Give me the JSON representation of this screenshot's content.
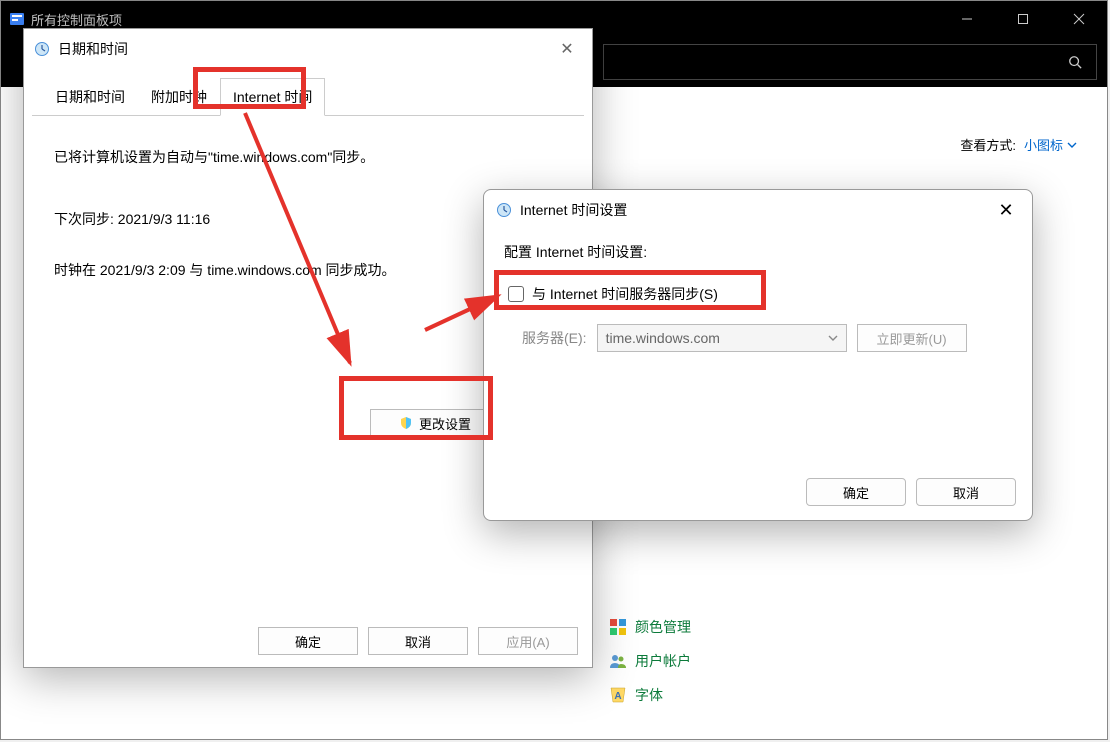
{
  "main_window": {
    "title": "所有控制面板项"
  },
  "view": {
    "label": "查看方式:",
    "link": "小图标"
  },
  "cp_items": [
    {
      "label": "颜色管理"
    },
    {
      "label": "用户帐户"
    },
    {
      "label": "字体"
    }
  ],
  "dt_dialog": {
    "title": "日期和时间",
    "tabs": [
      "日期和时间",
      "附加时钟",
      "Internet 时间"
    ],
    "active_tab": "Internet 时间",
    "line1": "已将计算机设置为自动与\"time.windows.com\"同步。",
    "line2": "下次同步: 2021/9/3 11:16",
    "line3": "时钟在 2021/9/3 2:09 与 time.windows.com 同步成功。",
    "change_btn": "更改设置",
    "ok": "确定",
    "cancel": "取消",
    "apply": "应用(A)"
  },
  "its_dialog": {
    "title": "Internet 时间设置",
    "config": "配置 Internet 时间设置:",
    "sync_label": "与 Internet 时间服务器同步(S)",
    "server_label": "服务器(E):",
    "server_value": "time.windows.com",
    "update_btn": "立即更新(U)",
    "ok": "确定",
    "cancel": "取消"
  }
}
